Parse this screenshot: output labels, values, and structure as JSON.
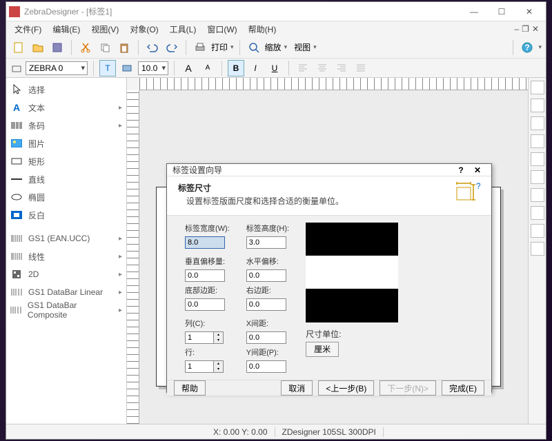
{
  "title": "ZebraDesigner - [标签1]",
  "titlebar": {
    "min": "—",
    "max": "☐",
    "close": "✕"
  },
  "menubar": [
    "文件(F)",
    "编辑(E)",
    "视图(V)",
    "对象(O)",
    "工具(L)",
    "窗口(W)",
    "帮助(H)"
  ],
  "mdi": {
    "min": "–",
    "restore": "❐",
    "close": "✕"
  },
  "toolbar1": {
    "print": "打印",
    "zoom": "缩放",
    "view": "视图"
  },
  "toolbar2": {
    "printer": "ZEBRA 0",
    "fontsize": "10.0",
    "bold": "B",
    "italic": "I",
    "underline": "U"
  },
  "sidebar": [
    {
      "label": "选择",
      "exp": false
    },
    {
      "label": "文本",
      "exp": true
    },
    {
      "label": "条码",
      "exp": true
    },
    {
      "label": "图片",
      "exp": false
    },
    {
      "label": "矩形",
      "exp": false
    },
    {
      "label": "直线",
      "exp": false
    },
    {
      "label": "椭圆",
      "exp": false
    },
    {
      "label": "反白",
      "exp": false
    },
    {
      "label": "GS1 (EAN.UCC)",
      "exp": true
    },
    {
      "label": "线性",
      "exp": true
    },
    {
      "label": "2D",
      "exp": true
    },
    {
      "label": "GS1 DataBar Linear",
      "exp": true
    },
    {
      "label": "GS1 DataBar Composite",
      "exp": true
    }
  ],
  "statusbar": {
    "coords": "X: 0.00 Y: 0.00",
    "printer": "ZDesigner 105SL 300DPI"
  },
  "dialog": {
    "title": "标签设置向导",
    "help_q": "?",
    "close": "✕",
    "hdr_title": "标签尺寸",
    "hdr_sub": "设置标签版面尺度和选择合适的衡量单位。",
    "labels": {
      "width": "标签宽度(W):",
      "height": "标签高度(H):",
      "voff": "垂直偏移量:",
      "hoff": "水平偏移:",
      "bmargin": "底部边距:",
      "rmargin": "右边距:",
      "cols": "列(C):",
      "xgap": "X间距:",
      "rows": "行:",
      "ygap": "Y间距(P):",
      "unit_lbl": "尺寸单位:",
      "unit_btn": "厘米"
    },
    "values": {
      "width": "8.0",
      "height": "3.0",
      "voff": "0.0",
      "hoff": "0.0",
      "bmargin": "0.0",
      "rmargin": "0.0",
      "cols": "1",
      "xgap": "0.0",
      "rows": "1",
      "ygap": "0.0"
    },
    "buttons": {
      "help": "帮助",
      "cancel": "取消",
      "back": "<上一步(B)",
      "next": "下一步(N)>",
      "finish": "完成(E)"
    }
  }
}
